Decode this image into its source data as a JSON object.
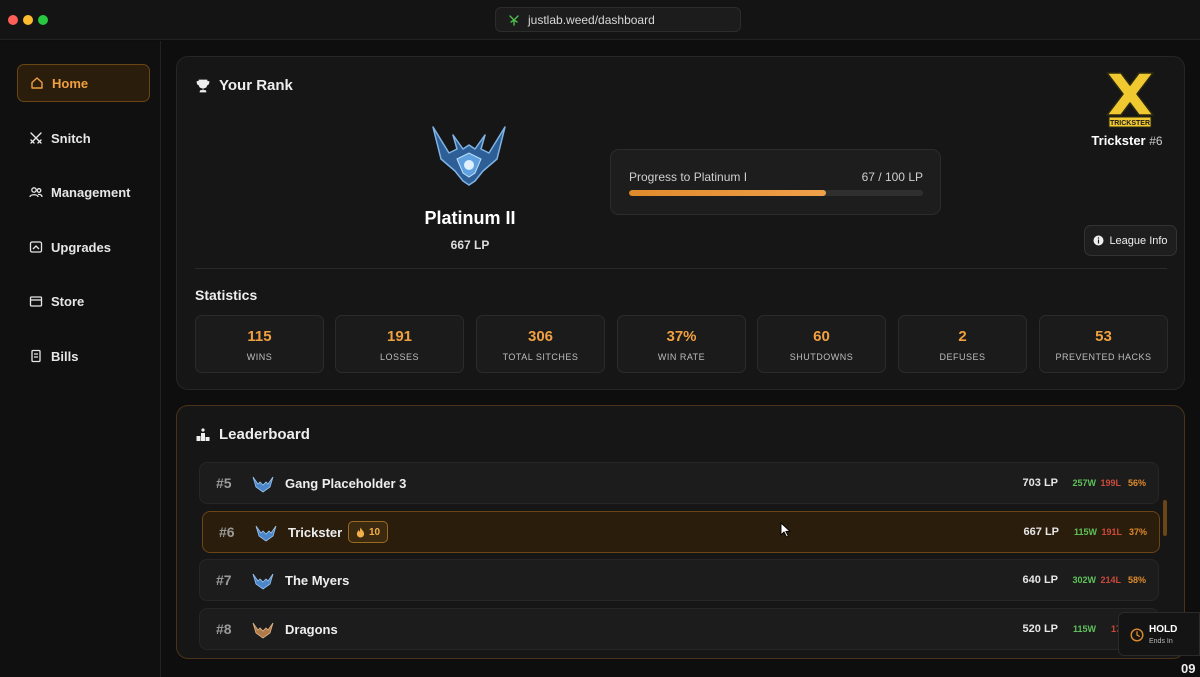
{
  "browser": {
    "url": "justlab.weed/dashboard"
  },
  "sidebar": {
    "items": [
      {
        "label": "Home",
        "icon": "home-icon",
        "active": true
      },
      {
        "label": "Snitch",
        "icon": "swords-icon",
        "active": false
      },
      {
        "label": "Management",
        "icon": "users-icon",
        "active": false
      },
      {
        "label": "Upgrades",
        "icon": "upgrade-icon",
        "active": false
      },
      {
        "label": "Store",
        "icon": "store-icon",
        "active": false
      },
      {
        "label": "Bills",
        "icon": "bill-icon",
        "active": false
      }
    ]
  },
  "rank": {
    "title": "Your Rank",
    "tier": "Platinum II",
    "lp": "667 LP",
    "progress_label": "Progress to Platinum I",
    "progress_value": "67 / 100 LP",
    "progress_fraction": 0.67,
    "team_name": "Trickster",
    "team_rank": "#6",
    "team_logo_text": "TRICKSTER",
    "league_info_label": "League Info"
  },
  "statistics": {
    "title": "Statistics",
    "items": [
      {
        "value": "115",
        "label": "WINS"
      },
      {
        "value": "191",
        "label": "LOSSES"
      },
      {
        "value": "306",
        "label": "TOTAL SITCHES"
      },
      {
        "value": "37%",
        "label": "WIN RATE"
      },
      {
        "value": "60",
        "label": "SHUTDOWNS"
      },
      {
        "value": "2",
        "label": "DEFUSES"
      },
      {
        "value": "53",
        "label": "PREVENTED HACKS"
      }
    ]
  },
  "leaderboard": {
    "title": "Leaderboard",
    "rows": [
      {
        "pos": "#5",
        "name": "Gang Placeholder 3",
        "lp": "703 LP",
        "w": "257W",
        "l": "199L",
        "wr": "56%",
        "me": false,
        "emblem_color": "#4a86c8"
      },
      {
        "pos": "#6",
        "name": "Trickster",
        "badge": "10",
        "lp": "667 LP",
        "w": "115W",
        "l": "191L",
        "wr": "37%",
        "me": true,
        "emblem_color": "#4a86c8"
      },
      {
        "pos": "#7",
        "name": "The Myers",
        "lp": "640 LP",
        "w": "302W",
        "l": "214L",
        "wr": "58%",
        "me": false,
        "emblem_color": "#4a86c8"
      },
      {
        "pos": "#8",
        "name": "Dragons",
        "lp": "520 LP",
        "w": "115W",
        "l": "17",
        "wr": "",
        "me": false,
        "emblem_color": "#b07a48"
      }
    ]
  },
  "hold_widget": {
    "title": "HOLD",
    "subtitle": "Ends In"
  },
  "corner_number": "09"
}
